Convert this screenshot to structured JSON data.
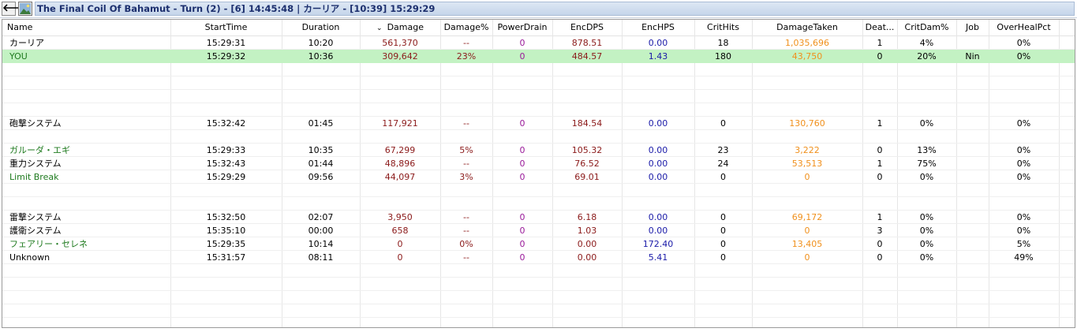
{
  "title": {
    "back_glyph": "🡐",
    "text": "The Final Coil Of Bahamut - Turn (2) - [6] 14:45:48 | カーリア - [10:39] 15:29:29"
  },
  "columns": [
    {
      "key": "name",
      "label": "Name"
    },
    {
      "key": "start",
      "label": "StartTime"
    },
    {
      "key": "duration",
      "label": "Duration"
    },
    {
      "key": "damage",
      "label": "Damage",
      "sort_glyph": "⌄"
    },
    {
      "key": "dmgpct",
      "label": "Damage%"
    },
    {
      "key": "powerdrain",
      "label": "PowerDrain"
    },
    {
      "key": "encdps",
      "label": "EncDPS"
    },
    {
      "key": "enchps",
      "label": "EncHPS"
    },
    {
      "key": "crithits",
      "label": "CritHits"
    },
    {
      "key": "dmgtaken",
      "label": "DamageTaken"
    },
    {
      "key": "deaths",
      "label": "Deat..."
    },
    {
      "key": "critdam",
      "label": "CritDam%"
    },
    {
      "key": "job",
      "label": "Job"
    },
    {
      "key": "overheal",
      "label": "OverHealPct"
    }
  ],
  "colors": {
    "name_default": "#000000",
    "name_pet": "#1e7a1e",
    "damage": "#8b1a1a",
    "dmgpct": "#8b1a1a",
    "powerdrain": "#9a1a9a",
    "encdps": "#8b1a1a",
    "enchps": "#1a1aa8",
    "dmgtaken": "#f0901c",
    "selected_bg": "#c3f2c3"
  },
  "rows": [
    {
      "name": "カーリア",
      "start": "15:29:31",
      "duration": "10:20",
      "damage": "561,370",
      "dmgpct": "--",
      "powerdrain": "0",
      "encdps": "878.51",
      "enchps": "0.00",
      "crithits": "18",
      "dmgtaken": "1,035,696",
      "deaths": "1",
      "critdam": "4%",
      "job": "",
      "overheal": "0%",
      "name_color": "default"
    },
    {
      "name": "YOU",
      "start": "15:29:32",
      "duration": "10:36",
      "damage": "309,642",
      "dmgpct": "23%",
      "powerdrain": "0",
      "encdps": "484.57",
      "enchps": "1.43",
      "crithits": "180",
      "dmgtaken": "43,750",
      "deaths": "0",
      "critdam": "20%",
      "job": "Nin",
      "overheal": "0%",
      "name_color": "pet",
      "selected": true
    },
    {
      "name": "砲撃システム",
      "start": "15:32:42",
      "duration": "01:45",
      "damage": "117,921",
      "dmgpct": "--",
      "powerdrain": "0",
      "encdps": "184.54",
      "enchps": "0.00",
      "crithits": "0",
      "dmgtaken": "130,760",
      "deaths": "1",
      "critdam": "0%",
      "job": "",
      "overheal": "0%",
      "name_color": "default"
    },
    {
      "name": "ガルーダ・エギ",
      "start": "15:29:33",
      "duration": "10:35",
      "damage": "67,299",
      "dmgpct": "5%",
      "powerdrain": "0",
      "encdps": "105.32",
      "enchps": "0.00",
      "crithits": "23",
      "dmgtaken": "3,222",
      "deaths": "0",
      "critdam": "13%",
      "job": "",
      "overheal": "0%",
      "name_color": "pet"
    },
    {
      "name": "重力システム",
      "start": "15:32:43",
      "duration": "01:44",
      "damage": "48,896",
      "dmgpct": "--",
      "powerdrain": "0",
      "encdps": "76.52",
      "enchps": "0.00",
      "crithits": "24",
      "dmgtaken": "53,513",
      "deaths": "1",
      "critdam": "75%",
      "job": "",
      "overheal": "0%",
      "name_color": "default"
    },
    {
      "name": "Limit Break",
      "start": "15:29:29",
      "duration": "09:56",
      "damage": "44,097",
      "dmgpct": "3%",
      "powerdrain": "0",
      "encdps": "69.01",
      "enchps": "0.00",
      "crithits": "0",
      "dmgtaken": "0",
      "deaths": "0",
      "critdam": "0%",
      "job": "",
      "overheal": "0%",
      "name_color": "pet"
    },
    {
      "name": "雷撃システム",
      "start": "15:32:50",
      "duration": "02:07",
      "damage": "3,950",
      "dmgpct": "--",
      "powerdrain": "0",
      "encdps": "6.18",
      "enchps": "0.00",
      "crithits": "0",
      "dmgtaken": "69,172",
      "deaths": "1",
      "critdam": "0%",
      "job": "",
      "overheal": "0%",
      "name_color": "default"
    },
    {
      "name": "護衛システム",
      "start": "15:35:10",
      "duration": "00:00",
      "damage": "658",
      "dmgpct": "--",
      "powerdrain": "0",
      "encdps": "1.03",
      "enchps": "0.00",
      "crithits": "0",
      "dmgtaken": "0",
      "deaths": "3",
      "critdam": "0%",
      "job": "",
      "overheal": "0%",
      "name_color": "default"
    },
    {
      "name": "フェアリー・セレネ",
      "start": "15:29:35",
      "duration": "10:14",
      "damage": "0",
      "dmgpct": "0%",
      "powerdrain": "0",
      "encdps": "0.00",
      "enchps": "172.40",
      "crithits": "0",
      "dmgtaken": "13,405",
      "deaths": "0",
      "critdam": "0%",
      "job": "",
      "overheal": "5%",
      "name_color": "pet"
    },
    {
      "name": "Unknown",
      "start": "15:31:57",
      "duration": "08:11",
      "damage": "0",
      "dmgpct": "--",
      "powerdrain": "0",
      "encdps": "0.00",
      "enchps": "5.41",
      "crithits": "0",
      "dmgtaken": "0",
      "deaths": "0",
      "critdam": "0%",
      "job": "",
      "overheal": "49%",
      "name_color": "default"
    }
  ]
}
